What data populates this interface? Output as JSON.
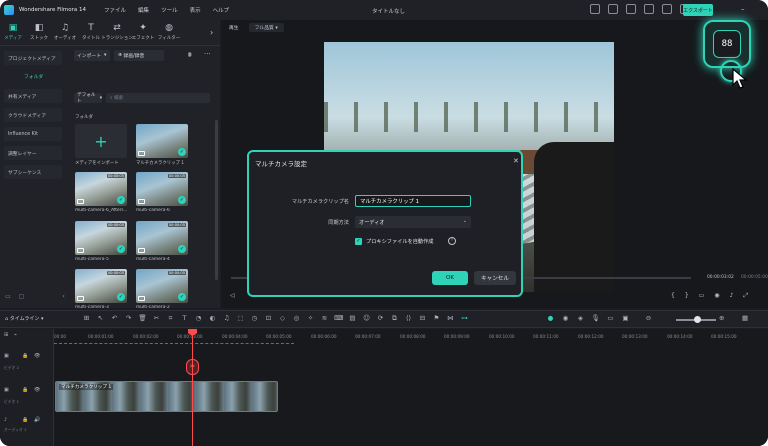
{
  "app": {
    "name": "Wondershare Filmora 14",
    "doc_title": "タイトルなし",
    "export_label": "エクスポート"
  },
  "menu": [
    "ファイル",
    "編集",
    "ツール",
    "表示",
    "ヘルプ"
  ],
  "media_tabs": [
    {
      "label": "メディア",
      "icon": "folder-icon"
    },
    {
      "label": "ストック",
      "icon": "stock-icon"
    },
    {
      "label": "オーディオ",
      "icon": "music-icon"
    },
    {
      "label": "タイトル",
      "icon": "title-icon"
    },
    {
      "label": "トランジション",
      "icon": "transition-icon"
    },
    {
      "label": "エフェクト",
      "icon": "effect-icon"
    },
    {
      "label": "フィルター",
      "icon": "filter-icon"
    }
  ],
  "sidebar": {
    "items": [
      {
        "label": "プロジェクトメディア",
        "type": "group"
      },
      {
        "label": "フォルダ",
        "type": "sub"
      },
      {
        "label": "共有メディア",
        "type": "group"
      },
      {
        "label": "クラウドメディア",
        "type": "group"
      },
      {
        "label": "Influence Kit",
        "type": "group"
      },
      {
        "label": "調整レイヤー",
        "type": "group"
      },
      {
        "label": "サブシーケンス",
        "type": "group"
      }
    ]
  },
  "media": {
    "import_label": "インポート",
    "record_label": "録画/録音",
    "sort_label": "デフォルト",
    "search_placeholder": "検索",
    "folder_label": "フォルダ",
    "items": [
      {
        "label": "メディアをインポート",
        "type": "import"
      },
      {
        "label": "マルチカメラクリップ 1",
        "duration": ""
      },
      {
        "label": "multi-camera-6_AfterI...",
        "duration": "00:00:05"
      },
      {
        "label": "multi-camera-6",
        "duration": "00:00:05"
      },
      {
        "label": "multi-camera-5",
        "duration": "00:00:05"
      },
      {
        "label": "multi-camera-4",
        "duration": "00:00:05"
      },
      {
        "label": "multi-camera-3",
        "duration": "00:00:05"
      },
      {
        "label": "multi-camera-2",
        "duration": "00:00:05"
      }
    ]
  },
  "preview": {
    "label": "再生",
    "quality": "フル品質",
    "time_current": "00:00:03:02",
    "time_total": "00:00:05:00"
  },
  "timeline": {
    "menu_label": "タイムライン",
    "ticks": [
      "00:00",
      "00:00:01:00",
      "00:00:02:00",
      "00:00:03:00",
      "00:00:04:00",
      "00:00:05:00",
      "00:00:06:00",
      "00:00:07:00",
      "00:00:08:00",
      "00:00:09:00",
      "00:00:10:00",
      "00:00:11:00",
      "00:00:12:00",
      "00:00:13:00",
      "00:00:14:00",
      "00:00:15:00"
    ],
    "clip_label": "マルチカメラクリップ 1",
    "tracks": [
      {
        "label": "ビデオ 2",
        "icon": "video-track-icon"
      },
      {
        "label": "ビデオ 1",
        "icon": "video-track-icon"
      },
      {
        "label": "オーディオ 1",
        "icon": "audio-track-icon"
      }
    ]
  },
  "dialog": {
    "title": "マルチカメラ設定",
    "name_label": "マルチカメラクリップ名",
    "name_value": "マルチカメラクリップ 1",
    "sync_label": "同期方法",
    "sync_value": "オーディオ",
    "proxy_label": "プロキシファイルを自動作成",
    "ok_label": "OK",
    "cancel_label": "キャンセル"
  },
  "highlight": {
    "icon": "multicam-view-icon",
    "glyph": "88"
  },
  "colors": {
    "accent": "#2fd3b7",
    "playhead": "#ff4b4b",
    "background": "#1b1d22"
  }
}
